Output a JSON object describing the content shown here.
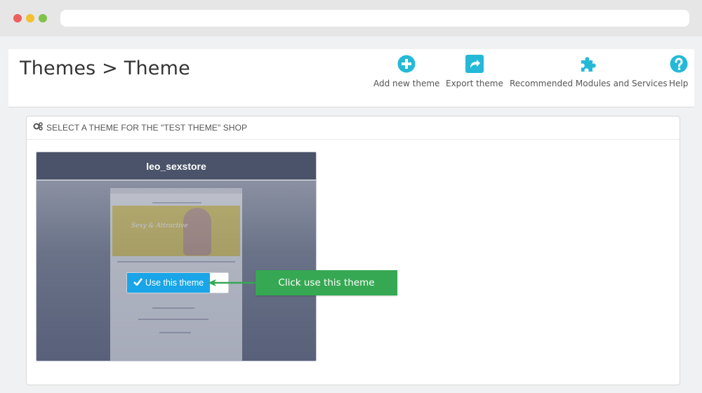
{
  "header": {
    "title": "Themes > Theme",
    "actions": [
      {
        "label": "Add new theme",
        "icon": "plus-circle-icon"
      },
      {
        "label": "Export theme",
        "icon": "export-share-icon"
      },
      {
        "label": "Recommended Modules and Services",
        "icon": "puzzle-piece-icon"
      },
      {
        "label": "Help",
        "icon": "help-question-icon"
      }
    ]
  },
  "panel": {
    "title": "SELECT A THEME FOR THE \"TEST THEME\" SHOP",
    "icon": "cogs-icon"
  },
  "theme_card": {
    "name": "leo_sexstore",
    "use_button_label": "Use this theme",
    "preview_banner_text": "Sexy & Attractive"
  },
  "annotation": {
    "callout_text": "Click use this theme"
  },
  "colors": {
    "accent": "#25b9d7",
    "button_blue": "#19a5e7",
    "card_header": "#4a5369",
    "callout_green": "#36a853"
  }
}
